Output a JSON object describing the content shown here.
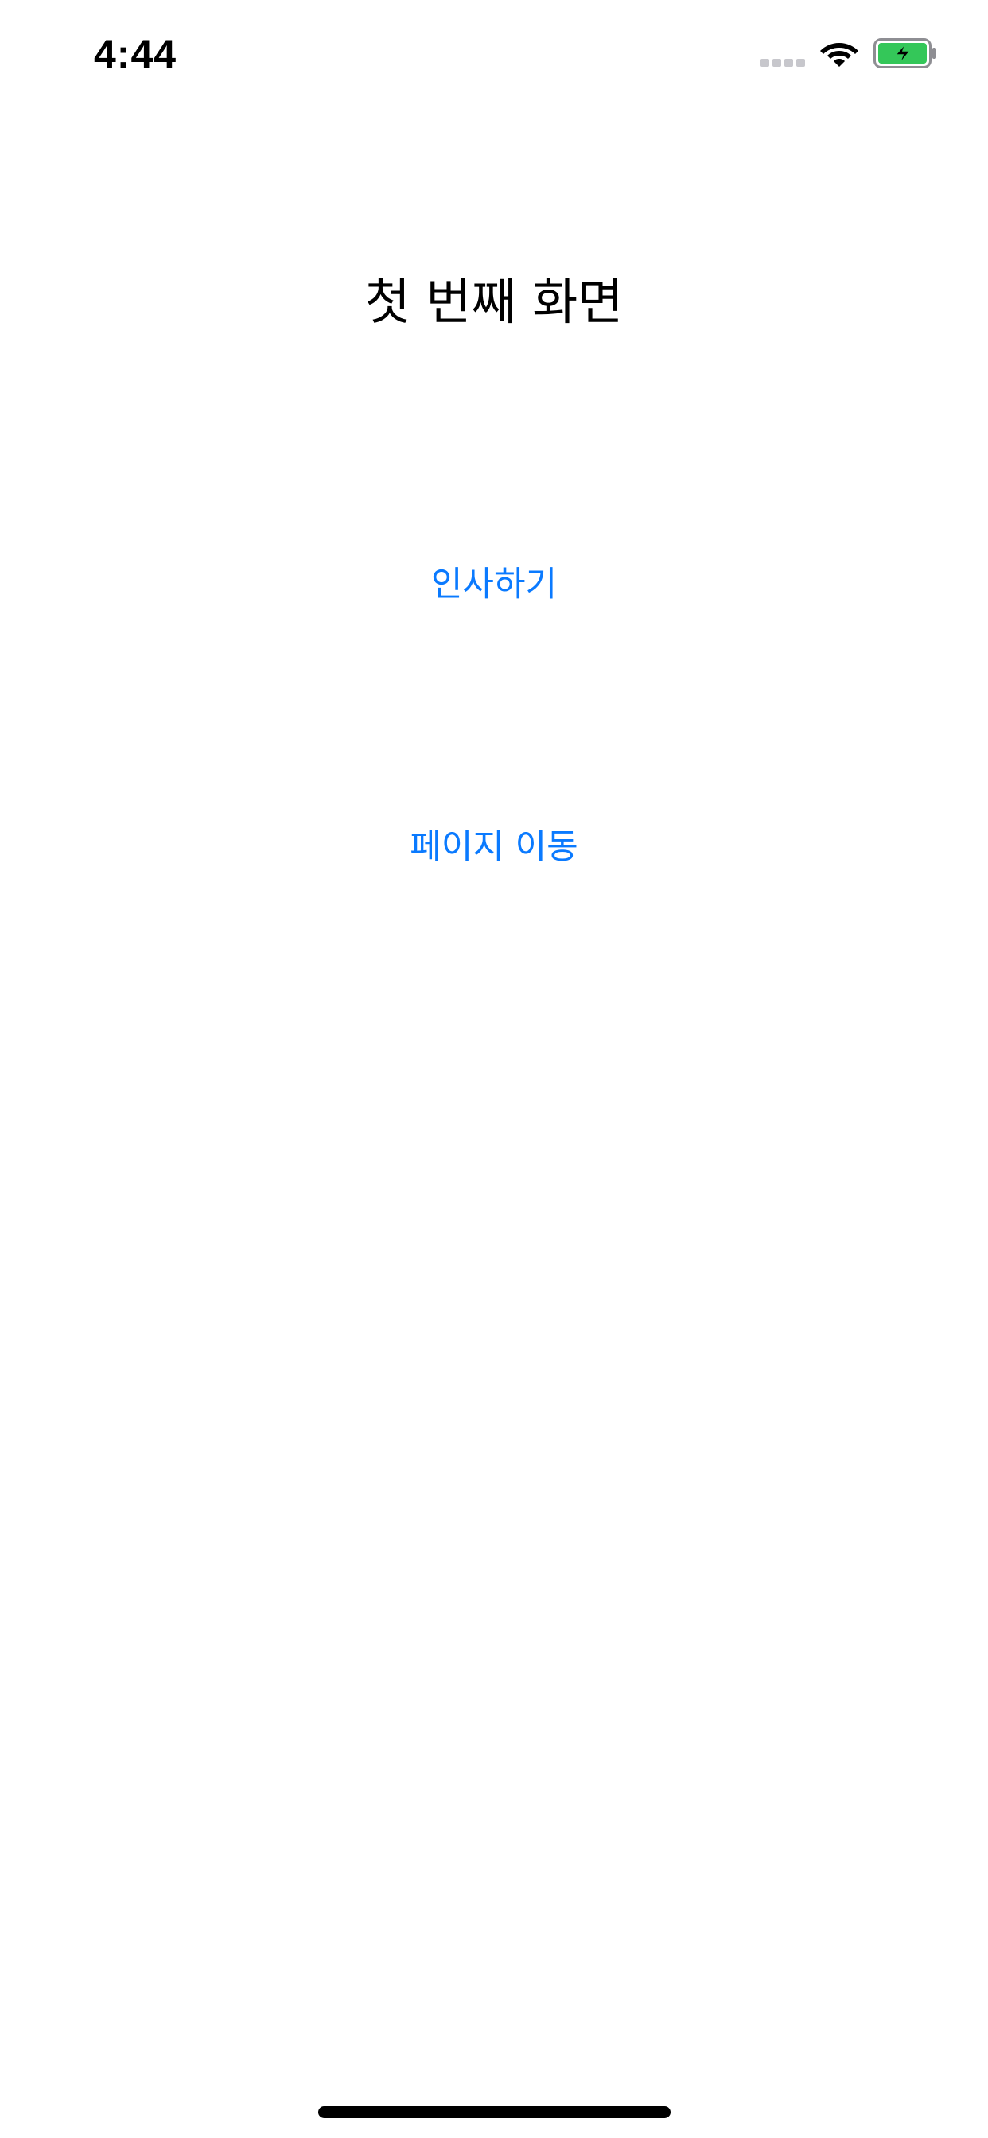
{
  "status_bar": {
    "time": "4:44",
    "icons": [
      "signal-dots-icon",
      "wifi-icon",
      "battery-charging-icon"
    ],
    "battery_color": "#34c759"
  },
  "main": {
    "title": "첫 번째 화면",
    "greet_button_label": "인사하기",
    "move_button_label": "페이지 이동",
    "accent_color": "#0a7aff"
  }
}
